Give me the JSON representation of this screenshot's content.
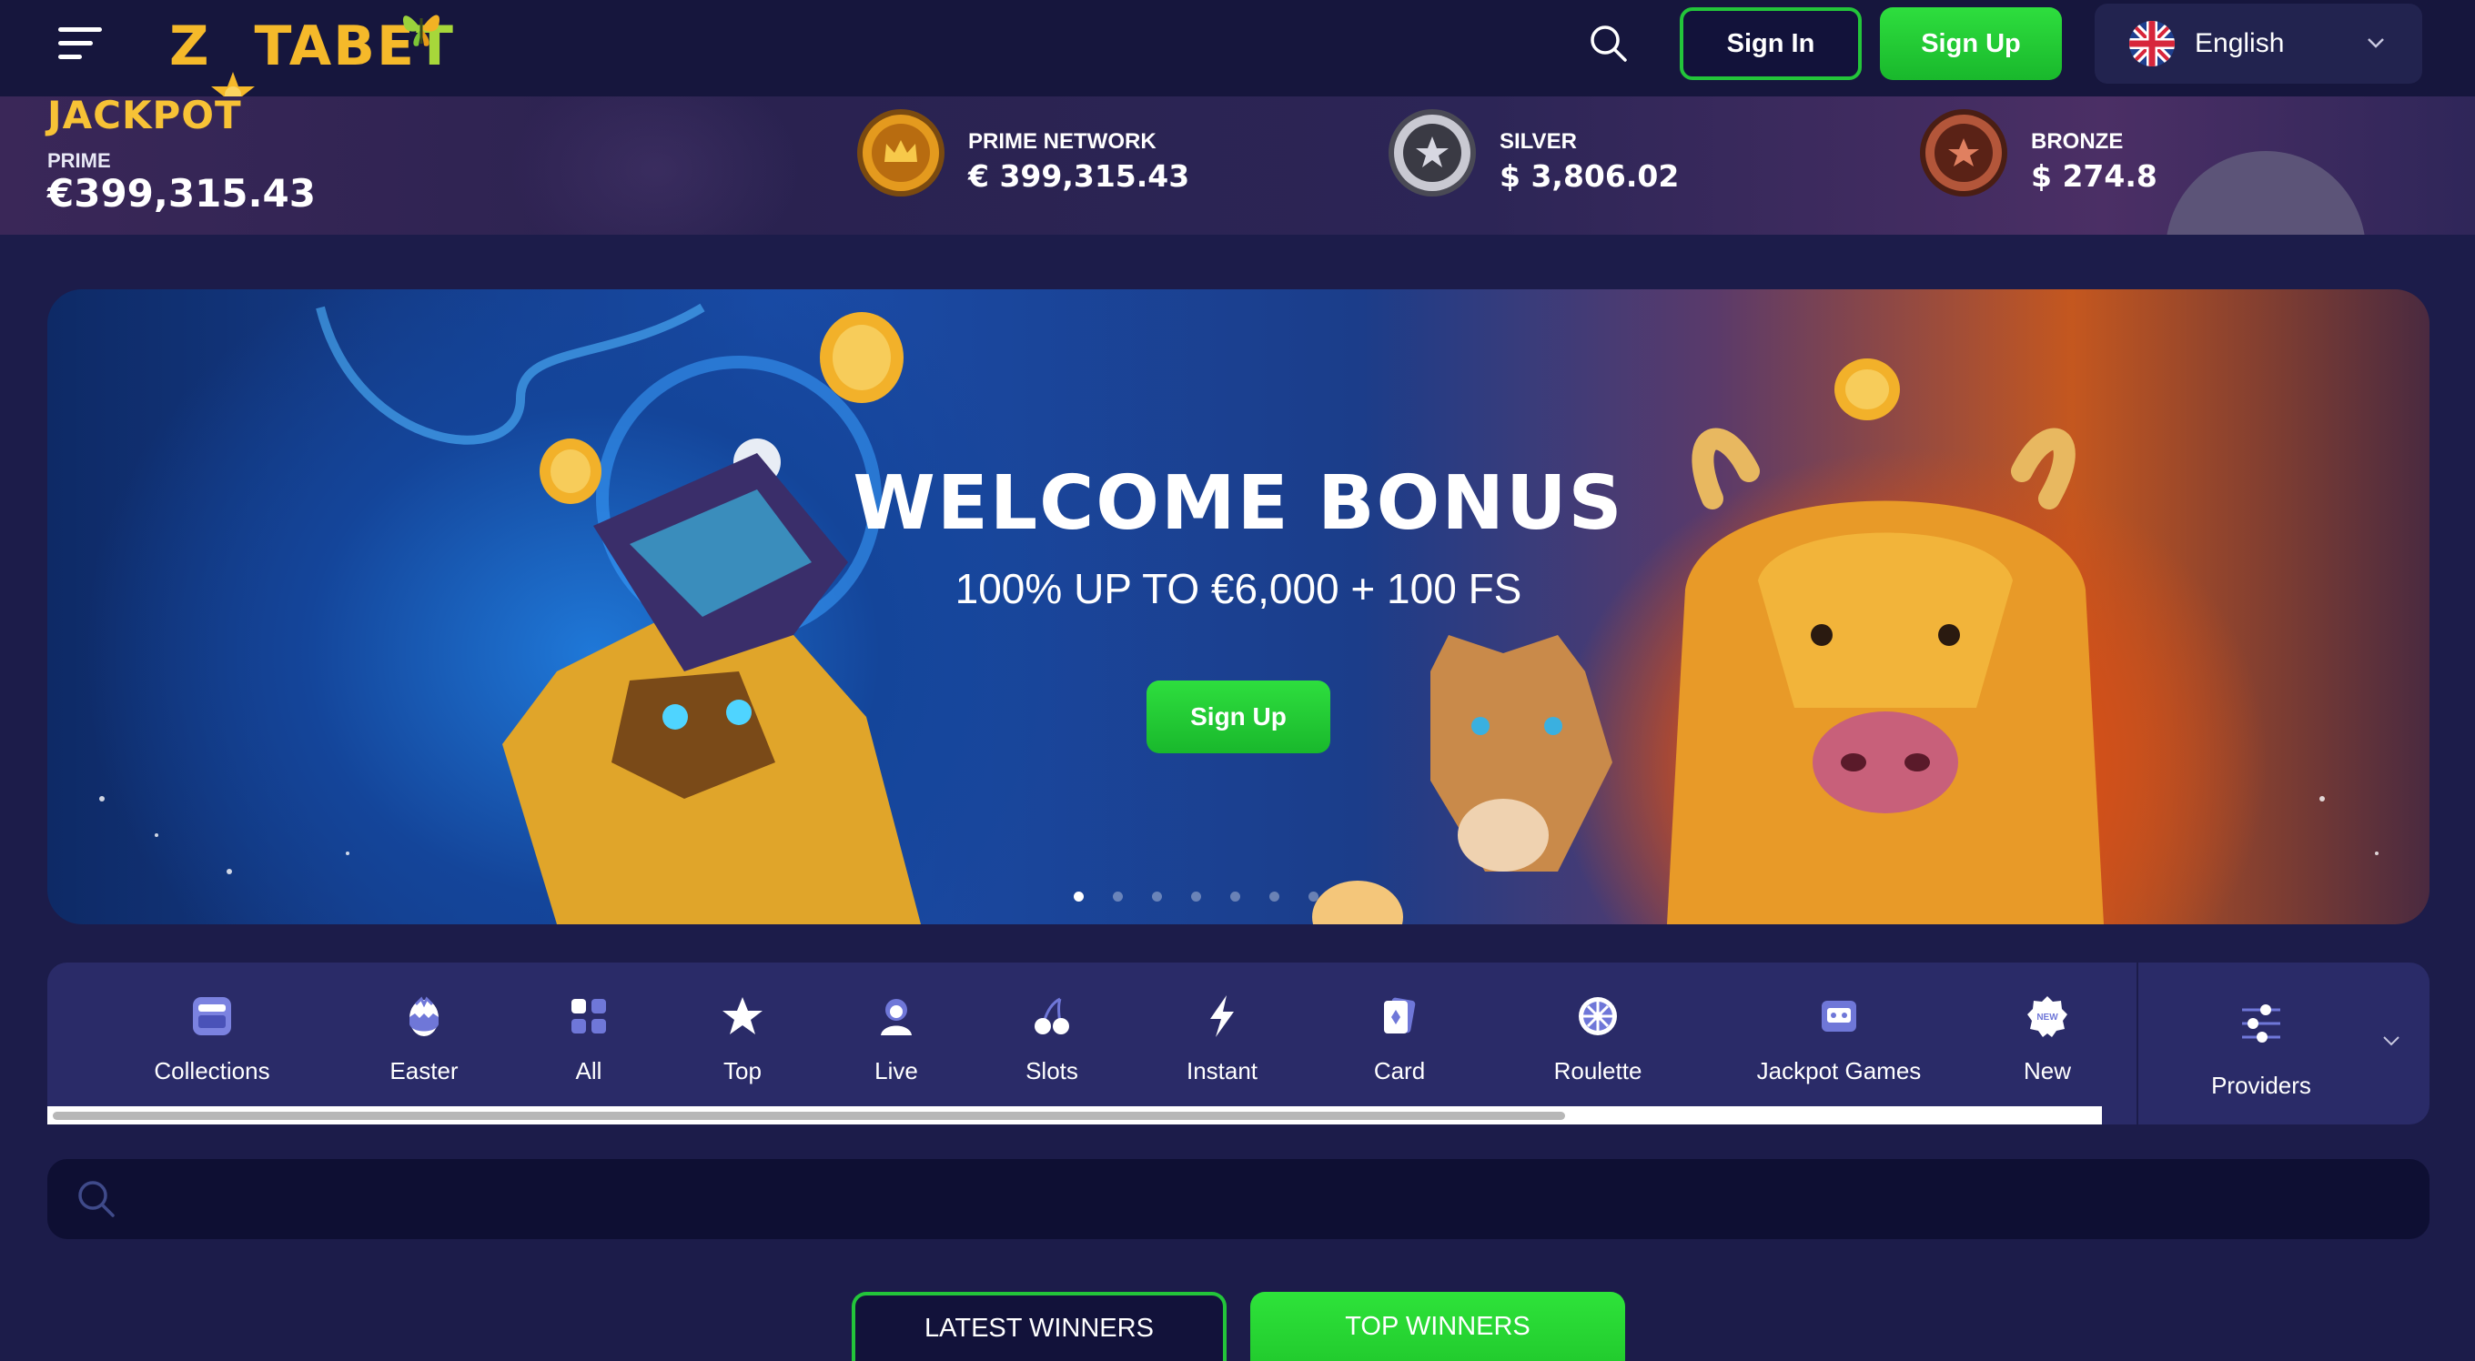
{
  "header": {
    "logo_part1": "Z",
    "logo_part2": "TABE",
    "logo_part3": "T",
    "sign_in_label": "Sign In",
    "sign_up_label": "Sign Up",
    "language": "English",
    "icons": [
      "menu-icon",
      "search-icon",
      "uk-flag-icon",
      "chevron-down-icon"
    ]
  },
  "jackpot": {
    "title": "JACKPOT",
    "prime_label": "PRIME",
    "prime_value": "€399,315.43",
    "items": [
      {
        "label": "PRIME NETWORK",
        "value": "€ 399,315.43",
        "icon": "gold-crown-coin-icon",
        "color": "#e49a1e"
      },
      {
        "label": "SILVER",
        "value": "$ 3,806.02",
        "icon": "silver-star-coin-icon",
        "color": "#b8b8c0"
      },
      {
        "label": "BRONZE",
        "value": "$ 274.8",
        "icon": "bronze-star-coin-icon",
        "color": "#a5442b"
      }
    ]
  },
  "banner": {
    "title": "WELCOME BONUS",
    "subtitle": "100% UP TO €6,000 + 100 FS",
    "cta_label": "Sign Up",
    "slide_count": 7,
    "active_slide": 0
  },
  "categories": {
    "items": [
      {
        "label": "Collections",
        "icon": "collections-icon"
      },
      {
        "label": "Easter",
        "icon": "easter-egg-icon"
      },
      {
        "label": "All",
        "icon": "grid-icon"
      },
      {
        "label": "Top",
        "icon": "star-icon"
      },
      {
        "label": "Live",
        "icon": "live-dealer-icon"
      },
      {
        "label": "Slots",
        "icon": "cherry-icon"
      },
      {
        "label": "Instant",
        "icon": "lightning-icon"
      },
      {
        "label": "Card",
        "icon": "card-icon"
      },
      {
        "label": "Roulette",
        "icon": "roulette-icon"
      },
      {
        "label": "Jackpot Games",
        "icon": "jackpot-machine-icon"
      },
      {
        "label": "New",
        "icon": "new-badge-icon"
      }
    ],
    "providers_label": "Providers",
    "scroll_progress": 0.74
  },
  "search": {
    "placeholder": "",
    "value": ""
  },
  "winners_tabs": {
    "latest_label": "LATEST WINNERS",
    "top_label": "TOP WINNERS",
    "active": "TOP WINNERS"
  },
  "colors": {
    "brand_green": "#23c53a",
    "page_bg": "#1c1c4a",
    "header_bg": "#16163d",
    "category_bg": "#2a2b68",
    "icon_accent": "#6f77d8"
  }
}
